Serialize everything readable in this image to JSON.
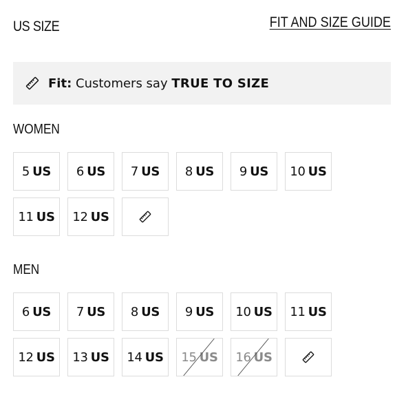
{
  "header": {
    "title": "US SIZE",
    "guide_link": "FIT AND SIZE GUIDE"
  },
  "fit": {
    "icon": "ruler-icon",
    "label": "Fit:",
    "text": "Customers say",
    "value": "TRUE TO SIZE",
    "background": "#f2f2f2"
  },
  "women": {
    "title": "WOMEN",
    "sizes": [
      {
        "num": "5",
        "unit": "US",
        "available": true
      },
      {
        "num": "6",
        "unit": "US",
        "available": true
      },
      {
        "num": "7",
        "unit": "US",
        "available": true
      },
      {
        "num": "8",
        "unit": "US",
        "available": true
      },
      {
        "num": "9",
        "unit": "US",
        "available": true
      },
      {
        "num": "10",
        "unit": "US",
        "available": true
      },
      {
        "num": "11",
        "unit": "US",
        "available": true
      },
      {
        "num": "12",
        "unit": "US",
        "available": true
      }
    ],
    "guide_icon": "ruler-icon"
  },
  "men": {
    "title": "MEN",
    "sizes": [
      {
        "num": "6",
        "unit": "US",
        "available": true
      },
      {
        "num": "7",
        "unit": "US",
        "available": true
      },
      {
        "num": "8",
        "unit": "US",
        "available": true
      },
      {
        "num": "9",
        "unit": "US",
        "available": true
      },
      {
        "num": "10",
        "unit": "US",
        "available": true
      },
      {
        "num": "11",
        "unit": "US",
        "available": true
      },
      {
        "num": "12",
        "unit": "US",
        "available": true
      },
      {
        "num": "13",
        "unit": "US",
        "available": true
      },
      {
        "num": "14",
        "unit": "US",
        "available": true
      },
      {
        "num": "15",
        "unit": "US",
        "available": false
      },
      {
        "num": "16",
        "unit": "US",
        "available": false
      }
    ],
    "guide_icon": "ruler-icon"
  },
  "colors": {
    "border": "#dcdcdc",
    "disabled_text": "#8a8a8a",
    "text": "#111111"
  }
}
